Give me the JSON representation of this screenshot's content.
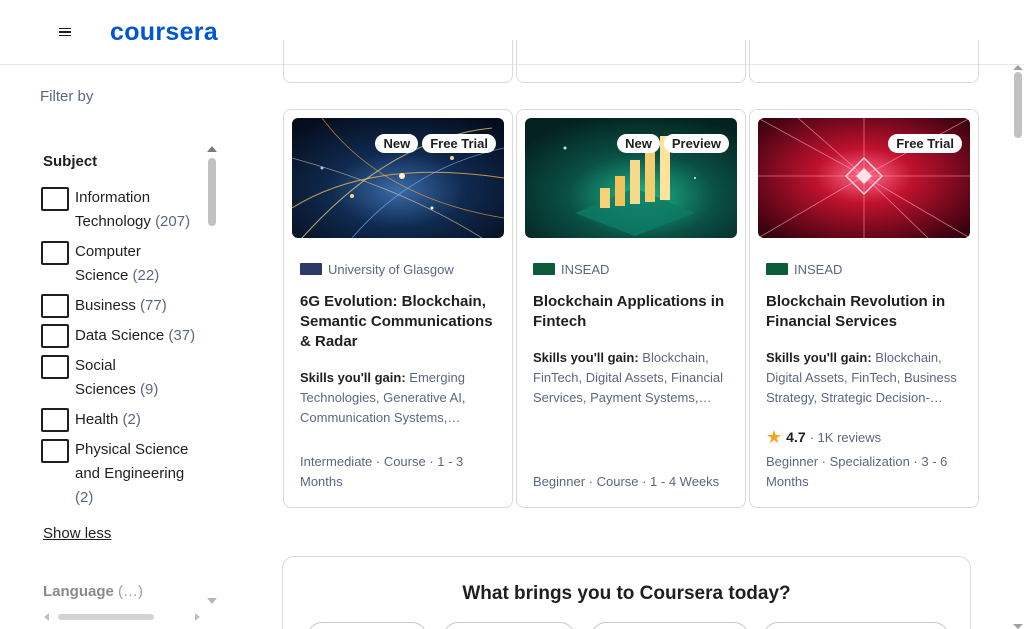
{
  "header": {
    "menu_icon": "hamburger-menu-icon",
    "logo_text": "coursera"
  },
  "sidebar": {
    "filter_by": "Filter by",
    "subject_title": "Subject",
    "subjects": [
      {
        "label": "Information Technology",
        "count": "(207)"
      },
      {
        "label": "Computer Science",
        "count": "(22)"
      },
      {
        "label": "Business",
        "count": "(77)"
      },
      {
        "label": "Data Science",
        "count": "(37)"
      },
      {
        "label": "Social Sciences",
        "count": "(9)"
      },
      {
        "label": "Health",
        "count": "(2)"
      },
      {
        "label": "Physical Science and Engineering",
        "count": "(2)"
      }
    ],
    "show_less": "Show less",
    "language_title": "Language",
    "language_count": "(…)"
  },
  "cards": [
    {
      "badges": [
        "New",
        "Free Trial"
      ],
      "partner": "University of Glasgow",
      "title": "6G Evolution: Blockchain, Semantic Communications & Radar",
      "skills_label": "Skills you'll gain:",
      "skills": "Emerging Technologies, Generative AI, Communication Systems,…",
      "meta": "Intermediate · Course · 1 - 3 Months"
    },
    {
      "badges": [
        "New",
        "Preview"
      ],
      "partner": "INSEAD",
      "title": "Blockchain Applications in Fintech",
      "skills_label": "Skills you'll gain:",
      "skills": "Blockchain, FinTech, Digital Assets, Financial Services, Payment Systems,…",
      "meta": "Beginner · Course · 1 - 4 Weeks"
    },
    {
      "badges": [
        "Free Trial"
      ],
      "partner": "INSEAD",
      "title": "Blockchain Revolution in Financial Services",
      "skills_label": "Skills you'll gain:",
      "skills": "Blockchain, Digital Assets, FinTech, Business Strategy, Strategic Decision-…",
      "rating": "4.7",
      "reviews": "· 1K reviews",
      "meta": "Beginner · Specialization · 3 - 6 Months"
    }
  ],
  "brings": {
    "title": "What brings you to Coursera today?"
  },
  "colors": {
    "brand": "#0056d2",
    "muted": "#5b6780",
    "star": "#f5a623"
  }
}
